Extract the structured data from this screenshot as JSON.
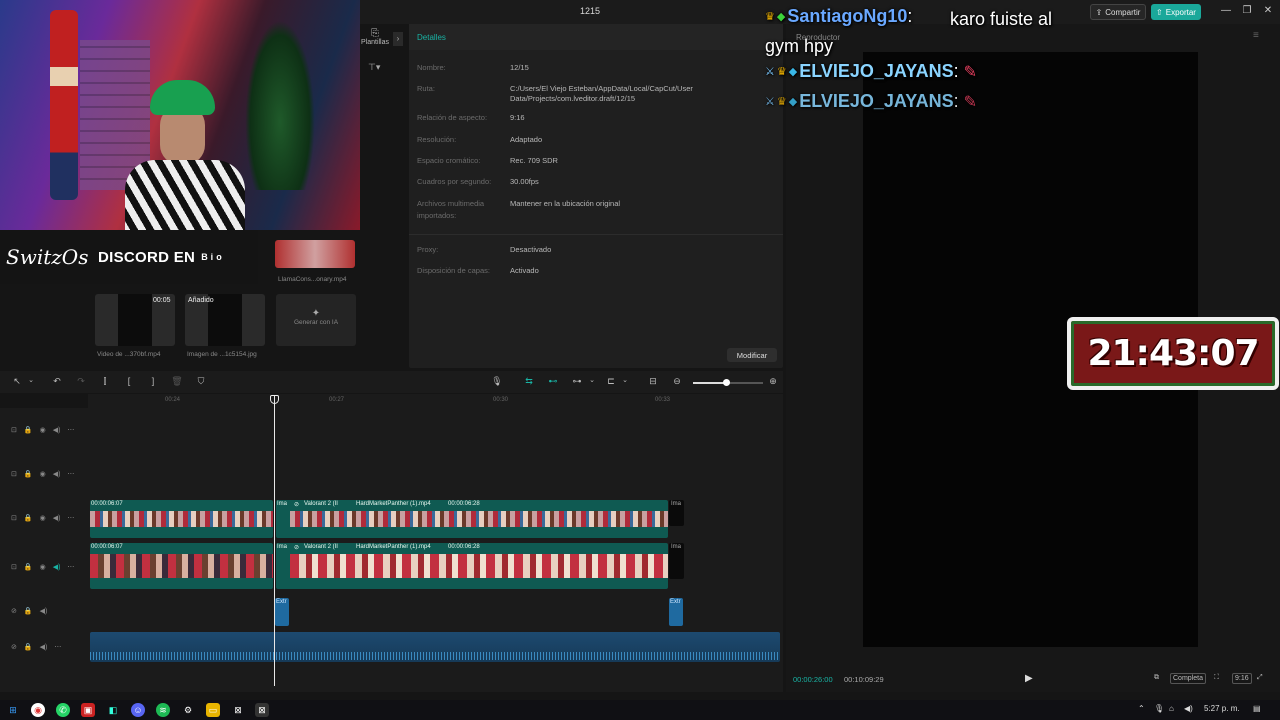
{
  "window": {
    "title": "1215"
  },
  "topbar": {
    "share": "Compartir",
    "export": "Exportar",
    "minimize": "—",
    "maximize": "❐",
    "close": "✕"
  },
  "media": {
    "templates_tab": "Plantillas",
    "thumbs": [
      {
        "label": "LlamaCons...onary.mp4",
        "badge": ""
      },
      {
        "label": "Video de ...370bf.mp4",
        "badge": "00:05"
      },
      {
        "label": "Imagen de ...1c5154.jpg",
        "badge": "Añadido"
      },
      {
        "label": "Generar con IA",
        "badge": ""
      }
    ]
  },
  "overlay": {
    "logo": "SwitzOs",
    "discord": "DISCORD EN",
    "bio": "Bio"
  },
  "details": {
    "title": "Detalles",
    "rows": [
      {
        "label": "Nombre:",
        "value": "12/15"
      },
      {
        "label": "Ruta:",
        "value": "C:/Users/El Viejo Esteban/AppData/Local/CapCut/User Data/Projects/com.lveditor.draft/12/15"
      },
      {
        "label": "Relación de aspecto:",
        "value": "9:16"
      },
      {
        "label": "Resolución:",
        "value": "Adaptado"
      },
      {
        "label": "Espacio cromático:",
        "value": "Rec. 709 SDR"
      },
      {
        "label": "Cuadros por segundo:",
        "value": "30.00fps"
      },
      {
        "label": "Archivos multimedia importados:",
        "value": "Mantener en la ubicación original"
      },
      {
        "label": "Proxy:",
        "value": "Desactivado"
      },
      {
        "label": "Disposición de capas:",
        "value": "Activado"
      }
    ],
    "modify": "Modificar"
  },
  "player": {
    "title": "Reproductor",
    "time_current": "00:00:26:00",
    "time_total": "00:10:09:29",
    "full": "Completa",
    "ratio": "9:16"
  },
  "chat": [
    {
      "user": "SantiagoNg10",
      "message": "karo fuiste al gym hpy",
      "color": "#6aa8ff"
    },
    {
      "user": "ELVIEJO_JAYANS",
      "message": "",
      "color": "#8ad4ff"
    },
    {
      "user": "ELVIEJO_JAYANS",
      "message": "",
      "color": "#8ad4ff"
    }
  ],
  "clock": {
    "time": "21:43:07"
  },
  "timeline": {
    "ruler": [
      "00:24",
      "00:27",
      "00:30",
      "00:33"
    ],
    "clip_a_time": "00:00:06:07",
    "clip_b_name": "Valorant 2 (II",
    "clip_c_name": "HardMarketPanther (1).mp4",
    "clip_c_time": "00:00:06:28",
    "clip_ima": "Ima",
    "effect": "Extr"
  },
  "taskbar": {
    "time": "5:27 p. m."
  }
}
